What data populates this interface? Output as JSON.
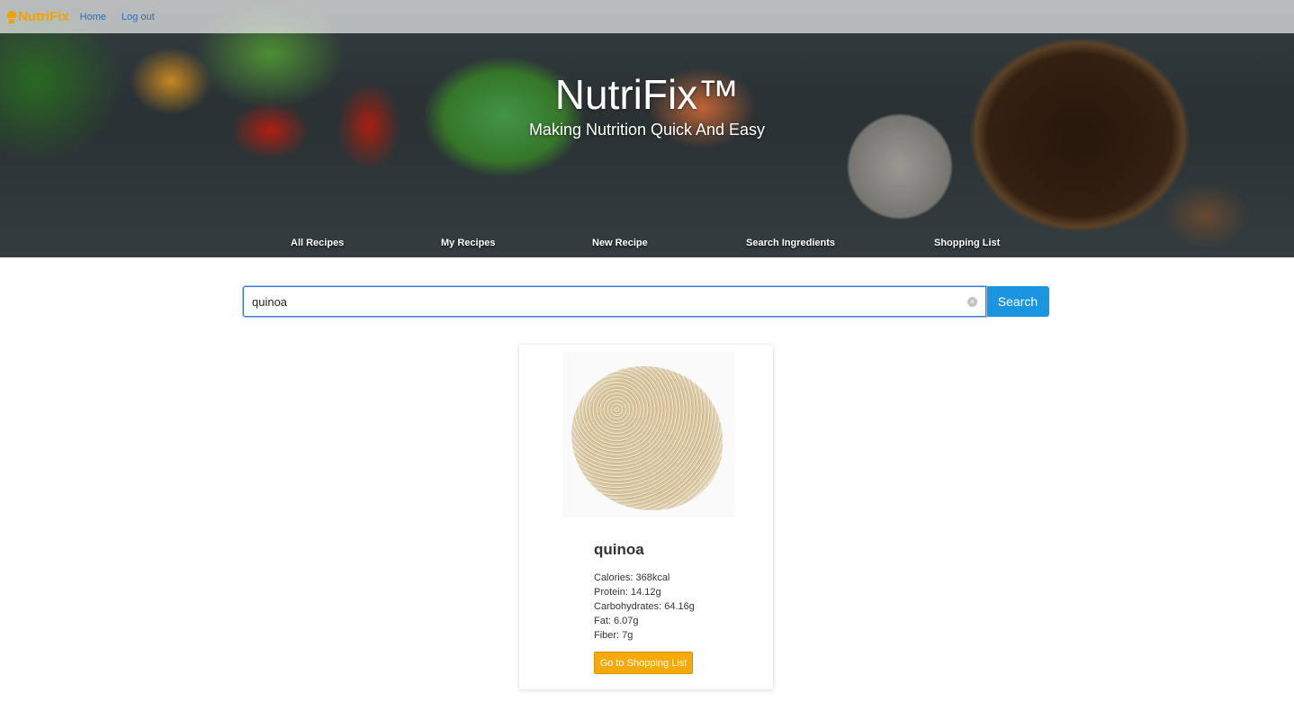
{
  "navbar": {
    "brand": "NutriFix",
    "links": [
      "Home",
      "Log out"
    ]
  },
  "hero": {
    "title": "NutriFix™",
    "subtitle": "Making Nutrition Quick And Easy"
  },
  "menu": {
    "items": [
      "All Recipes",
      "My Recipes",
      "New Recipe",
      "Search Ingredients",
      "Shopping List"
    ]
  },
  "search": {
    "value": "quinoa",
    "button_label": "Search"
  },
  "result": {
    "name": "quinoa",
    "nutrients": [
      "Calories: 368kcal",
      "Protein: 14.12g",
      "Carbohydrates: 64.16g",
      "Fat: 6.07g",
      "Fiber: 7g"
    ],
    "button_label": "Go to Shopping List"
  },
  "colors": {
    "brand": "#f0a300",
    "link": "#2a6fbd",
    "search_button": "#1a95e0",
    "shop_button": "#f5a90a"
  }
}
